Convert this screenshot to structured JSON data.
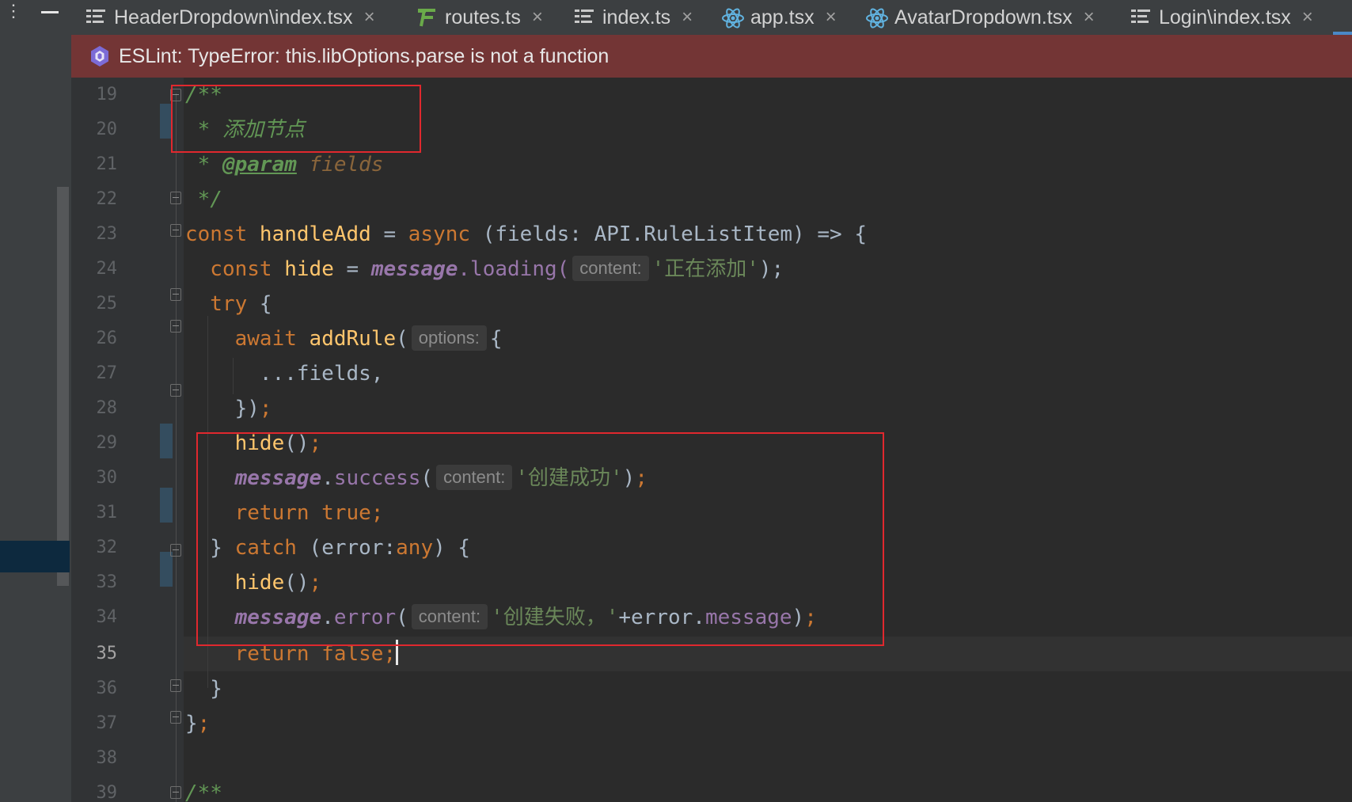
{
  "tabs": [
    {
      "label": "HeaderDropdown\\index.tsx",
      "icon": "structure-icon"
    },
    {
      "label": "routes.ts",
      "icon": "routes-icon"
    },
    {
      "label": "index.ts",
      "icon": "structure-icon"
    },
    {
      "label": "app.tsx",
      "icon": "react-icon"
    },
    {
      "label": "AvatarDropdown.tsx",
      "icon": "react-icon"
    },
    {
      "label": "Login\\index.tsx",
      "icon": "structure-icon"
    }
  ],
  "close_glyph": "×",
  "error": {
    "message": "ESLint: TypeError: this.libOptions.parse is not a function"
  },
  "current_line": 35,
  "line_numbers": [
    "19",
    "20",
    "21",
    "22",
    "23",
    "24",
    "25",
    "26",
    "27",
    "28",
    "29",
    "30",
    "31",
    "32",
    "33",
    "34",
    "35",
    "36",
    "37",
    "38",
    "39"
  ],
  "hints": {
    "content": "content:",
    "options": "options:"
  },
  "code": {
    "l19": "/**",
    "l20_star": " * ",
    "l20_text": "添加节点",
    "l21_star": " * ",
    "l21_tag": "@param",
    "l21_name": " fields",
    "l22": " */",
    "l23_const": "const ",
    "l23_name": "handleAdd",
    "l23_eq": " = ",
    "l23_async": "async",
    "l23_rest": " (fields: API.RuleListItem) => {",
    "l24_const": "  const ",
    "l24_var": "hide",
    "l24_eq": " = ",
    "l24_obj": "message",
    "l24_method": ".loading(",
    "l24_str": "'正在添加'",
    "l24_end": ");",
    "l25_try": "  try",
    "l25_brace": " {",
    "l26_await": "    await ",
    "l26_fn": "addRule",
    "l26_paren": "(",
    "l26_brace": "{",
    "l27": "      ...fields,",
    "l28_close": "    })",
    "l28_semi": ";",
    "l29_fn": "    hide",
    "l29_paren": "()",
    "l29_semi": ";",
    "l30_obj": "    message",
    "l30_dot": ".",
    "l30_method": "success",
    "l30_paren": "(",
    "l30_str": "'创建成功'",
    "l30_end": ")",
    "l30_semi": ";",
    "l31": "    return true;",
    "l32_open": "  } ",
    "l32_catch": "catch",
    "l32_paren": " (error:",
    "l32_any": "any",
    "l32_close": ") {",
    "l33_fn": "    hide",
    "l33_paren": "()",
    "l33_semi": ";",
    "l34_obj": "    message",
    "l34_dot": ".",
    "l34_method": "error",
    "l34_paren": "(",
    "l34_str": "'创建失败，'",
    "l34_plus": "+error.",
    "l34_prop": "message",
    "l34_end": ")",
    "l34_semi": ";",
    "l35": "    return false;",
    "l36": "  }",
    "l37_brace": "}",
    "l37_semi": ";",
    "l39": "/**"
  },
  "colors": {
    "keyword": "#cc7832",
    "function": "#ffc66d",
    "string": "#6a8759",
    "comment": "#629755",
    "error_bar": "#733535",
    "highlight_box": "#e0282e"
  }
}
